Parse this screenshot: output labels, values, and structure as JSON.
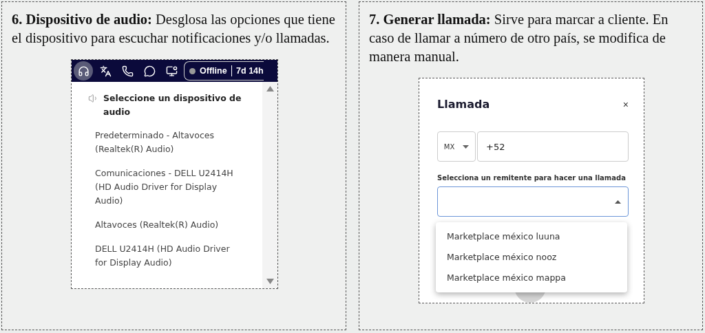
{
  "cards": [
    {
      "description": "**6. Dispositivo de audio:** Desglosa las opciones que tiene el dispositivo para escuchar notificaciones y/o llamadas.",
      "toolbar": {
        "icons": [
          {
            "kind": "headset",
            "selected": true
          },
          {
            "kind": "translate",
            "selected": false
          },
          {
            "kind": "phone",
            "selected": false
          },
          {
            "kind": "whatsapp",
            "selected": false
          },
          {
            "kind": "monitor",
            "selected": false
          }
        ],
        "status": {
          "label": "Offline",
          "timer": "7d 14h"
        }
      },
      "audio_menu": {
        "title": "Seleccione un dispositivo de audio",
        "options": [
          "Predeterminado - Altavoces (Realtek(R) Audio)",
          "Comunicaciones - DELL U2414H (HD Audio Driver for Display Audio)",
          "Altavoces (Realtek(R) Audio)",
          "DELL U2414H (HD Audio Driver for Display Audio)"
        ]
      }
    },
    {
      "description": "**7. Generar llamada:** Sirve para marcar a cliente. En caso de llamar a número de otro país, se modifica de manera manual.",
      "dialog": {
        "title": "Llamada",
        "close": "×",
        "country": "MX",
        "phone": "+52",
        "sender_label": "Selecciona un remitente para hacer una llamada",
        "sender_select": {
          "expanded": true,
          "options": [
            "Marketplace méxico luuna",
            "Marketplace méxico nooz",
            "Marketplace méxico mappa"
          ]
        }
      }
    }
  ]
}
